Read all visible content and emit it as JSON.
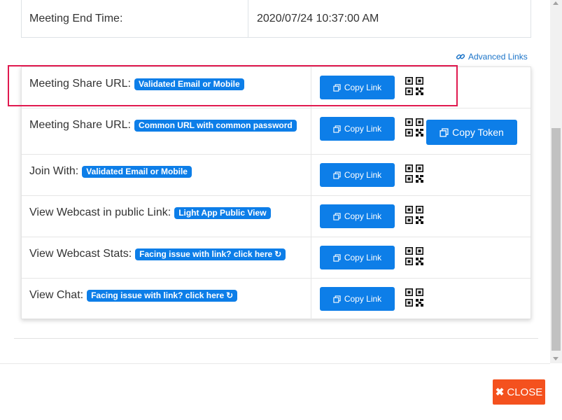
{
  "meeting_end": {
    "label": "Meeting End Time:",
    "value": "2020/07/24 10:37:00 AM"
  },
  "advanced_links": {
    "label": "Advanced Links",
    "icon": "link-icon"
  },
  "rows": [
    {
      "label": "Meeting Share URL:",
      "badge": "Validated Email or Mobile",
      "badge_refresh": false,
      "button": "Copy Link",
      "highlighted": true
    },
    {
      "label": "Meeting Share URL:",
      "badge": "Common URL with common password",
      "badge_refresh": false,
      "button": "Copy Link",
      "extra_button": "Copy Token"
    },
    {
      "label": "Join With:",
      "badge": "Validated Email or Mobile",
      "badge_refresh": false,
      "button": "Copy Link"
    },
    {
      "label": "View Webcast in public Link:",
      "badge": "Light App Public View",
      "badge_refresh": false,
      "button": "Copy Link"
    },
    {
      "label": "View Webcast Stats:",
      "badge": "Facing issue with link? click here",
      "badge_refresh": true,
      "button": "Copy Link"
    },
    {
      "label": "View Chat:",
      "badge": "Facing issue with link? click here",
      "badge_refresh": true,
      "button": "Copy Link"
    }
  ],
  "footer": {
    "close_label": "CLOSE"
  },
  "colors": {
    "primary": "#0d7ee8",
    "close": "#f4511e",
    "highlight": "#e0194f",
    "link": "#1a73c8"
  }
}
